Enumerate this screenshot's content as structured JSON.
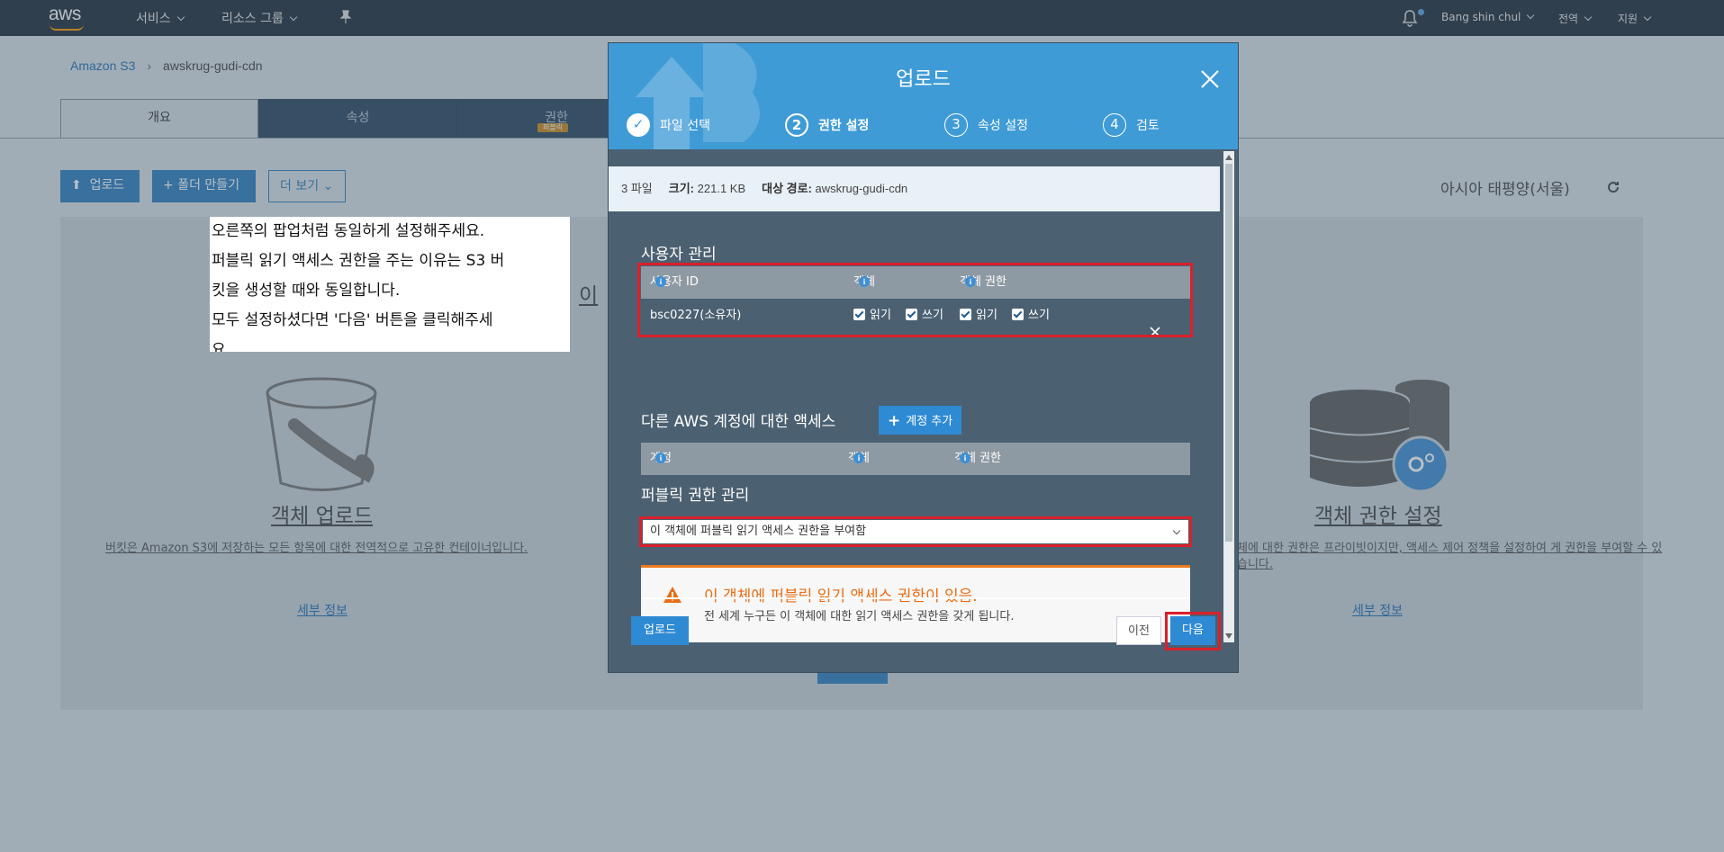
{
  "topnav": {
    "logo": "aws",
    "services": "서비스",
    "resource_groups": "리소스 그룹",
    "user": "Bang shin chul",
    "region": "전역",
    "support": "지원"
  },
  "breadcrumb": {
    "root": "Amazon S3",
    "current": "awskrug-gudi-cdn"
  },
  "tabs": [
    {
      "label": "개요",
      "active": true
    },
    {
      "label": "속성"
    },
    {
      "label": "권한",
      "badge": "퍼블릭"
    }
  ],
  "actions": {
    "upload": "업로드",
    "create_folder": "폴더 만들기",
    "more": "더 보기"
  },
  "region_label": "아시아 태평양(서울)",
  "cards": {
    "upload_title": "객체 업로드",
    "upload_desc": "버킷은 Amazon S3에 저장하는 모든 항목에 대한 전역적으로 고유한 컨테이너입니다.",
    "upload_link": "세부 정보",
    "middle_partial": "이 ",
    "perm_title": "객체 권한 설정",
    "perm_desc": "체에 대한 권한은 프라이빗이지만, 액세스 제어 정책을 설정하여 게 권한을 부여할 수 있습니다.",
    "perm_link": "세부 정보"
  },
  "note": {
    "lines": [
      "오른쪽의 팝업처럼 동일하게 설정해주세요.",
      "퍼블릭 읽기 액세스 권한을 주는 이유는 S3 버",
      "킷을 생성할 때와 동일합니다.",
      "모두 설정하셨다면 '다음' 버튼을 클릭해주세",
      "요."
    ]
  },
  "modal": {
    "title": "업로드",
    "steps": [
      {
        "num": "✓",
        "label": "파일 선택",
        "state": "done"
      },
      {
        "num": "2",
        "label": "권한 설정",
        "state": "active"
      },
      {
        "num": "3",
        "label": "속성 설정",
        "state": "todo"
      },
      {
        "num": "4",
        "label": "검토",
        "state": "todo"
      }
    ],
    "info": {
      "files": "3 파일",
      "size_label": "크기:",
      "size_value": "221.1 KB",
      "dest_label": "대상 경로:",
      "dest_value": "awskrug-gudi-cdn"
    },
    "user_mgmt": {
      "title": "사용자 관리",
      "col_user": "사용자 ID",
      "col_object": "객체",
      "col_object_perm": "객체 권한",
      "row_user": "bsc0227(소유자)",
      "read": "읽기",
      "write": "쓰기"
    },
    "other_accounts": {
      "title": "다른 AWS 계정에 대한 액세스",
      "add_button": "계정 추가",
      "col_account": "계정",
      "col_object": "객체",
      "col_object_perm": "객체 권한"
    },
    "public": {
      "title": "퍼블릭 권한 관리",
      "selected": "이 객체에 퍼블릭 읽기 액세스 권한을 부여함"
    },
    "warning": {
      "title": "이 객체에 퍼블릭 읽기 액세스 권한이 있음.",
      "desc": "전 세계 누구든 이 객체에 대한 읽기 액세스 권한을 갖게 됩니다."
    },
    "buttons": {
      "upload": "업로드",
      "prev": "이전",
      "next": "다음"
    }
  },
  "colors": {
    "nav_bg": "#232f3e",
    "modal_header": "#3f9bd6",
    "modal_body": "#4b6071",
    "highlight": "#d9202b",
    "warning": "#e86d14"
  }
}
